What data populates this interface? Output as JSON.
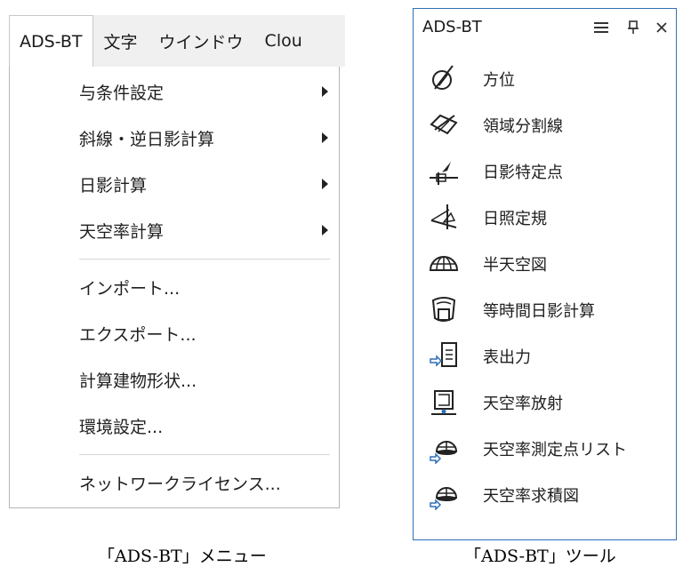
{
  "menu": {
    "menubar": [
      "ADS-BT",
      "文字",
      "ウインドウ",
      "Clou"
    ],
    "items": [
      {
        "label": "与条件設定",
        "submenu": true
      },
      {
        "label": "斜線・逆日影計算",
        "submenu": true
      },
      {
        "label": "日影計算",
        "submenu": true
      },
      {
        "label": "天空率計算",
        "submenu": true
      },
      {
        "label": "インポート...",
        "submenu": false
      },
      {
        "label": "エクスポート...",
        "submenu": false
      },
      {
        "label": "計算建物形状...",
        "submenu": false
      },
      {
        "label": "環境設定...",
        "submenu": false
      },
      {
        "label": "ネットワークライセンス...",
        "submenu": false
      }
    ],
    "caption": "「ADS-BT」メニュー"
  },
  "palette": {
    "title": "ADS-BT",
    "tools": [
      {
        "label": "方位",
        "icon": "azimuth-icon"
      },
      {
        "label": "領域分割線",
        "icon": "region-split-line-icon"
      },
      {
        "label": "日影特定点",
        "icon": "shadow-point-icon"
      },
      {
        "label": "日照定規",
        "icon": "sun-ruler-icon"
      },
      {
        "label": "半天空図",
        "icon": "half-sky-diagram-icon"
      },
      {
        "label": "等時間日影計算",
        "icon": "isochrone-shadow-icon"
      },
      {
        "label": "表出力",
        "icon": "table-output-icon"
      },
      {
        "label": "天空率放射",
        "icon": "sky-factor-radiation-icon"
      },
      {
        "label": "天空率測定点リスト",
        "icon": "sky-factor-point-list-icon"
      },
      {
        "label": "天空率求積図",
        "icon": "sky-factor-area-diagram-icon"
      }
    ],
    "caption": "「ADS-BT」ツール"
  }
}
